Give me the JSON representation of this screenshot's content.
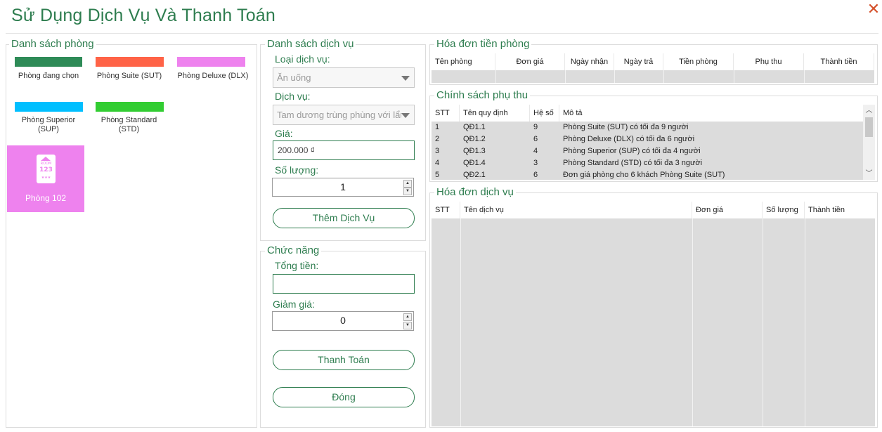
{
  "window": {
    "title": "Sử Dụng Dịch Vụ Và Thanh Toán",
    "close_glyph": "✕"
  },
  "rooms_panel": {
    "label": "Danh sách phòng",
    "legend": [
      {
        "label": "Phòng đang chọn",
        "color": "#2e8b57"
      },
      {
        "label": "Phòng Suite (SUT)",
        "color": "#ff6347"
      },
      {
        "label": "Phòng Deluxe (DLX)",
        "color": "#ee82ee"
      },
      {
        "label": "Phòng Superior (SUP)",
        "color": "#00bfff"
      },
      {
        "label": "Phòng Standard (STD)",
        "color": "#32cd32"
      }
    ],
    "rooms": [
      {
        "name": "Phòng 102",
        "color": "#ee82ee",
        "icon": "room-123-icon",
        "icon_text_top": "ROOM",
        "icon_text_num": "123"
      }
    ]
  },
  "services_panel": {
    "label": "Danh sách dịch vụ",
    "type_label": "Loại dịch vụ:",
    "type_value": "Ăn uống",
    "service_label": "Dịch vụ:",
    "service_value": "Tam dương trùng phùng với lẩu",
    "price_label": "Giá:",
    "price_value": "200.000 ₫",
    "qty_label": "Số lượng:",
    "qty_value": "1",
    "add_button": "Thêm Dịch Vụ"
  },
  "functions_panel": {
    "label": "Chức năng",
    "total_label": "Tổng tiền:",
    "total_value": "",
    "discount_label": "Giảm giá:",
    "discount_value": "0",
    "pay_button": "Thanh Toán",
    "close_button": "Đóng"
  },
  "room_invoice": {
    "label": "Hóa đơn tiền phòng",
    "columns": [
      "Tên phòng",
      "Đơn giá",
      "Ngày nhận",
      "Ngày trả",
      "Tiền phòng",
      "Phụ thu",
      "Thành tiền"
    ],
    "rows": []
  },
  "surcharge_policy": {
    "label": "Chính sách phụ thu",
    "columns": [
      "STT",
      "Tên quy định",
      "Hệ số",
      "Mô tả"
    ],
    "rows": [
      {
        "stt": "1",
        "code": "QĐ1.1",
        "factor": "9",
        "desc": "Phòng Suite (SUT) có tối đa 9 người"
      },
      {
        "stt": "2",
        "code": "QĐ1.2",
        "factor": "6",
        "desc": "Phòng Deluxe (DLX) có tối đa 6 người"
      },
      {
        "stt": "3",
        "code": "QĐ1.3",
        "factor": "4",
        "desc": "Phòng Superior (SUP) có tối đa 4 người"
      },
      {
        "stt": "4",
        "code": "QĐ1.4",
        "factor": "3",
        "desc": "Phòng Standard (STD) có tối đa 3 người"
      },
      {
        "stt": "5",
        "code": "QĐ2.1",
        "factor": "6",
        "desc": "Đơn giá phòng cho 6 khách Phòng Suite (SUT)"
      }
    ]
  },
  "service_invoice": {
    "label": "Hóa đơn dịch vụ",
    "columns": [
      "STT",
      "Tên dịch vụ",
      "Đơn giá",
      "Số lượng",
      "Thành tiền"
    ],
    "rows": []
  }
}
